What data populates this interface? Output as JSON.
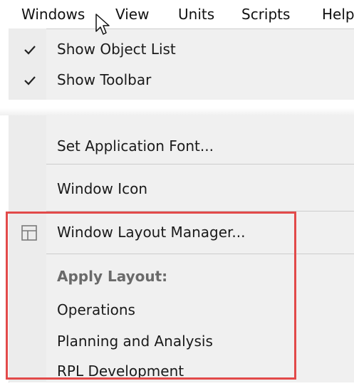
{
  "menubar": {
    "items": [
      "Windows",
      "View",
      "Units",
      "Scripts",
      "Help"
    ]
  },
  "dropdown": {
    "show_object_list": "Show Object List",
    "show_toolbar": "Show Toolbar",
    "set_app_font": "Set Application Font...",
    "window_icon": "Window Icon",
    "layout_manager": "Window Layout Manager...",
    "apply_layout_header": "Apply Layout:",
    "layouts": [
      "Operations",
      "Planning and Analysis",
      "RPL Development"
    ]
  },
  "icons": {
    "check": "check-icon",
    "layout": "layout-icon",
    "cursor": "mouse-pointer-icon"
  },
  "colors": {
    "highlight": "#e24a4a",
    "menu_bg": "#f0f0f0"
  }
}
